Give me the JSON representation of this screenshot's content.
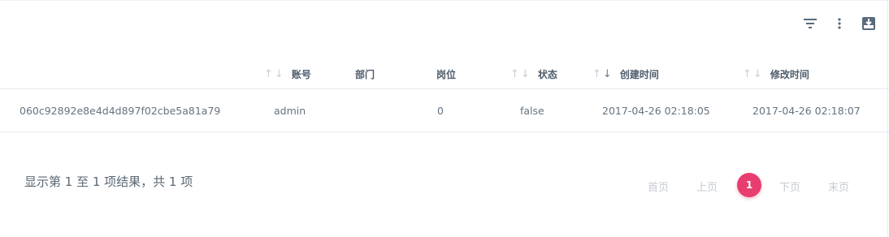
{
  "toolbar": {
    "filter_icon": "filter-icon",
    "more_icon": "more-vertical-icon",
    "export_icon": "download-box-icon"
  },
  "table": {
    "columns": [
      {
        "label": "",
        "sortable": false
      },
      {
        "label": "账号",
        "sortable": true,
        "sort": "none"
      },
      {
        "label": "部门",
        "sortable": false
      },
      {
        "label": "岗位",
        "sortable": false
      },
      {
        "label": "状态",
        "sortable": true,
        "sort": "none"
      },
      {
        "label": "创建时间",
        "sortable": true,
        "sort": "desc"
      },
      {
        "label": "修改时间",
        "sortable": true,
        "sort": "none"
      }
    ],
    "rows": [
      {
        "id": "060c92892e8e4d4d897f02cbe5a81a79",
        "account": "admin",
        "dept": "",
        "post": "0",
        "status": "false",
        "created": "2017-04-26 02:18:05",
        "modified": "2017-04-26 02:18:07"
      }
    ]
  },
  "footer": {
    "info": "显示第 1 至 1 项结果，共 1 项",
    "first": "首页",
    "prev": "上页",
    "current": "1",
    "next": "下页",
    "last": "末页"
  },
  "colors": {
    "accent": "#e83e6f",
    "text": "#5f6b7a",
    "muted": "#c6cbd1"
  }
}
